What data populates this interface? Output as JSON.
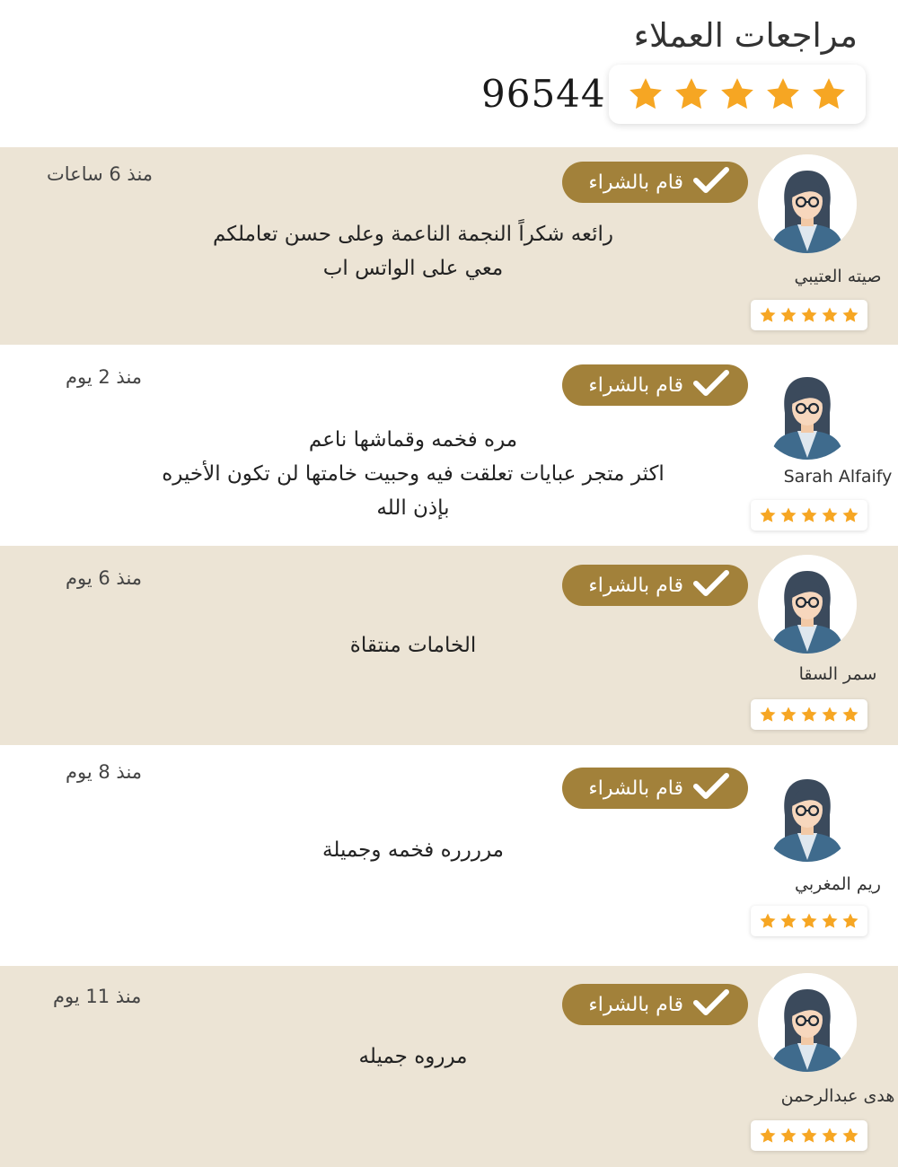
{
  "header": {
    "title": "مراجعات العملاء",
    "total_reviews": "96544",
    "star_rating": 5
  },
  "colors": {
    "accent_gold": "#a2813a",
    "shaded_row": "#ece4d5",
    "star": "#f6a623"
  },
  "reviews": [
    {
      "name": "صيته العتيبي",
      "time": "منذ 6 ساعات",
      "badge": "قام بالشراء",
      "text": "رائعه شكراً النجمة الناعمة وعلى حسن تعاملكم\nمعي على الواتس اب",
      "stars": 5
    },
    {
      "name": "Sarah Alfaify",
      "time": "منذ 2 يوم",
      "badge": "قام بالشراء",
      "text": "مره فخمه وقماشها ناعم\nاكثر متجر عبايات تعلقت فيه وحبيت خامتها لن تكون الأخيره\nبإذن الله",
      "stars": 5
    },
    {
      "name": "سمر السقا",
      "time": "منذ 6 يوم",
      "badge": "قام بالشراء",
      "text": "الخامات منتقاة",
      "stars": 5
    },
    {
      "name": "ريم المغربي",
      "time": "منذ 8 يوم",
      "badge": "قام بالشراء",
      "text": "مرررره فخمه وجميلة",
      "stars": 5
    },
    {
      "name": "هدى عبدالرحمن",
      "time": "منذ 11 يوم",
      "badge": "قام بالشراء",
      "text": "مرروه جميله",
      "stars": 5
    }
  ],
  "icons": {
    "star": "star-icon",
    "check": "check-icon",
    "avatar": "user-avatar-icon"
  }
}
